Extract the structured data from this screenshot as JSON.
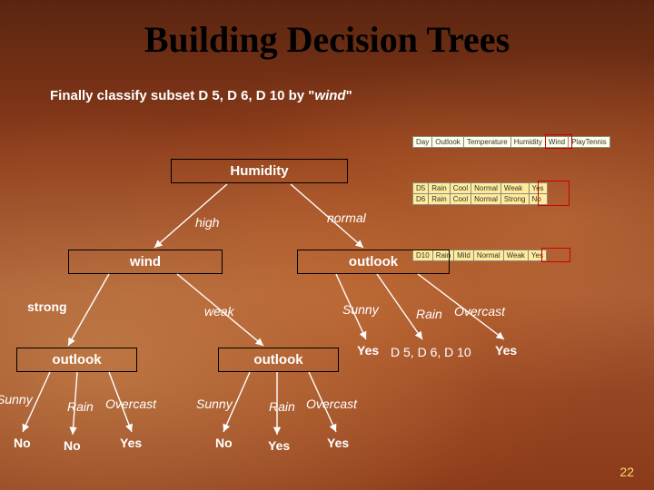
{
  "title": "Building Decision Trees",
  "subtitle_prefix": "Finally classify subset D 5, D 6, D 10 by  \"",
  "subtitle_keyword": "wind",
  "subtitle_suffix": "\"",
  "nodes": {
    "humidity": "Humidity",
    "wind": "wind",
    "outlook": "outlook"
  },
  "edges": {
    "high": "high",
    "normal": "normal",
    "strong": "strong",
    "weak": "weak",
    "sunny": "Sunny",
    "rain": "Rain",
    "overcast": "Overcast"
  },
  "leaves": {
    "yes": "Yes",
    "no": "No",
    "d_subset": "D 5, D 6, D 10",
    "yes_subset_left": "Yes",
    "yes_subset_right": "Yes"
  },
  "table": {
    "headers": [
      "Day",
      "Outlook",
      "Temperature",
      "Humidity",
      "Wind",
      "PlayTennis"
    ],
    "rows_top": [
      [
        "D5",
        "Rain",
        "Cool",
        "Normal",
        "Weak",
        "Yes"
      ],
      [
        "D6",
        "Rain",
        "Cool",
        "Normal",
        "Strong",
        "No"
      ]
    ],
    "rows_bottom": [
      [
        "D10",
        "Rain",
        "Mild",
        "Normal",
        "Weak",
        "Yes"
      ]
    ]
  },
  "page_number": "22"
}
